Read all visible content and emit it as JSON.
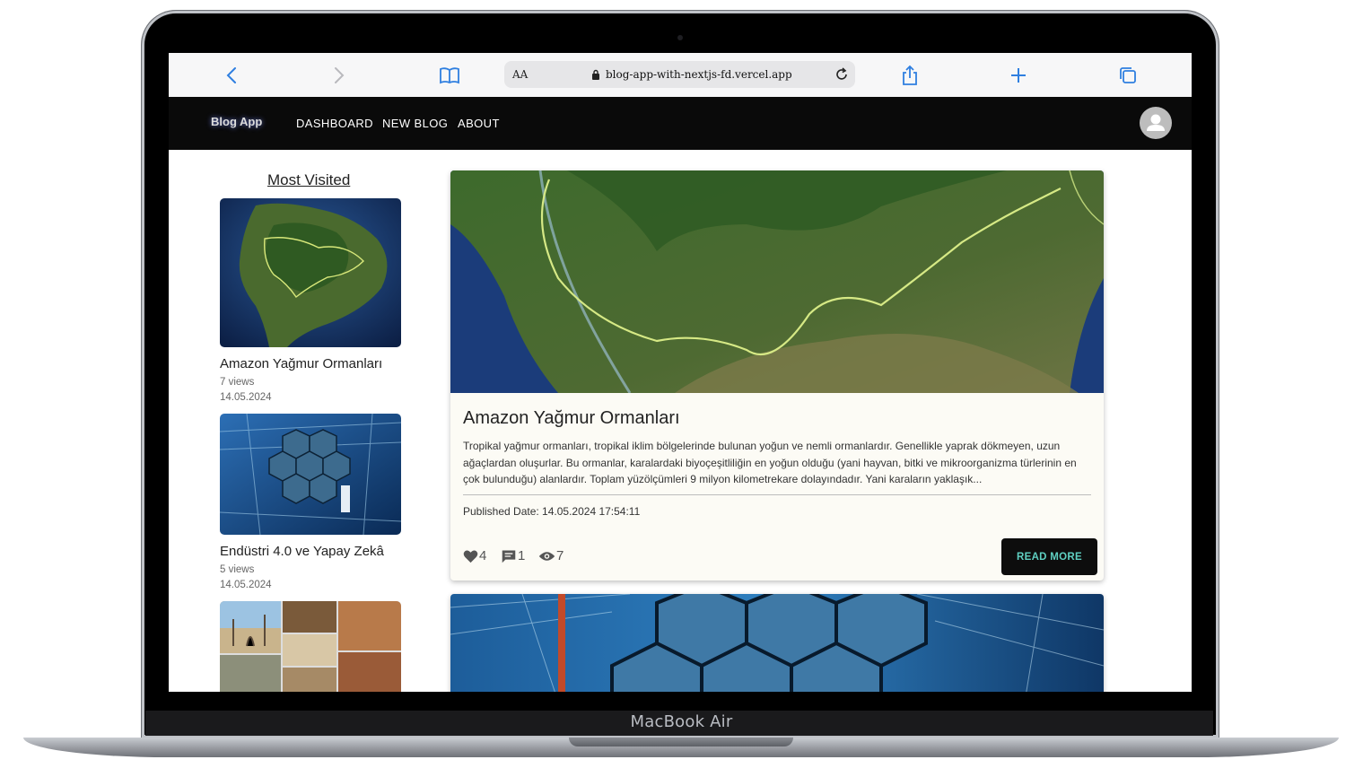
{
  "device": {
    "label": "MacBook Air"
  },
  "browser": {
    "reader_label": "AA",
    "url": "blog-app-with-nextjs-fd.vercel.app",
    "icons": [
      "chevron-left-icon",
      "chevron-right-icon",
      "book-icon",
      "lock-icon",
      "reload-icon",
      "share-icon",
      "plus-icon",
      "tabs-icon"
    ]
  },
  "nav": {
    "logo": "Blog App",
    "links": [
      "DASHBOARD",
      "NEW BLOG",
      "ABOUT"
    ],
    "avatar_icon": "person-icon"
  },
  "sidebar": {
    "title": "Most Visited",
    "items": [
      {
        "title": "Amazon Yağmur Ormanları",
        "views": "7 views",
        "date": "14.05.2024"
      },
      {
        "title": "Endüstri 4.0 ve Yapay Zekâ",
        "views": "5 views",
        "date": "14.05.2024"
      }
    ]
  },
  "post": {
    "title": "Amazon Yağmur Ormanları",
    "excerpt": "Tropikal yağmur ormanları, tropikal iklim bölgelerinde bulunan yoğun ve nemli ormanlardır. Genellikle yaprak dökmeyen, uzun ağaçlardan oluşurlar. Bu ormanlar, karalardaki biyoçeşitliliğin en yoğun olduğu (yani hayvan, bitki ve mikroorganizma türlerinin en çok bulunduğu) alanlardır. Toplam yüzölçümleri 9 milyon kilometrekare dolayındadır. Yani karaların yaklaşık...",
    "published": "Published Date: 14.05.2024 17:54:11",
    "likes": "4",
    "comments": "1",
    "views": "7",
    "read_more": "READ MORE"
  },
  "colors": {
    "appbar": "#0a0a0a",
    "card_bg": "#fcfbf5",
    "button_text": "#5fd0c2",
    "toolbar_icon": "#2f7fe0"
  }
}
